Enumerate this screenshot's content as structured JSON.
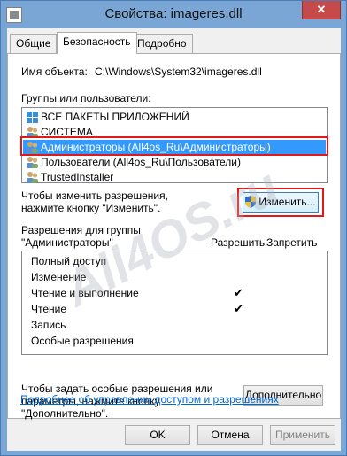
{
  "window": {
    "title": "Свойства: imageres.dll",
    "close_glyph": "✕"
  },
  "tabs": [
    {
      "label": "Общие"
    },
    {
      "label": "Безопасность"
    },
    {
      "label": "Подробно"
    }
  ],
  "security": {
    "object_label": "Имя объекта:",
    "object_value": "C:\\Windows\\System32\\imageres.dll",
    "groups_label": "Группы или пользователи:",
    "groups": [
      "ВСЕ ПАКЕТЫ ПРИЛОЖЕНИЙ",
      "СИСТЕМА",
      "Администраторы (All4os_Ru\\Администраторы)",
      "Пользователи (All4os_Ru\\Пользователи)",
      "TrustedInstaller"
    ],
    "selected_group_index": 2,
    "change_hint": "Чтобы изменить разрешения,\nнажмите кнопку \"Изменить\".",
    "change_hint_line1": "Чтобы изменить разрешения,",
    "change_hint_line2": "нажмите кнопку \"Изменить\".",
    "change_button": "Изменить...",
    "perm_label_line1": "Разрешения для группы",
    "perm_label_line2": "\"Администраторы\"",
    "allow_header": "Разрешить",
    "deny_header": "Запретить",
    "permissions": [
      {
        "name": "Полный доступ",
        "allow": false,
        "deny": false
      },
      {
        "name": "Изменение",
        "allow": false,
        "deny": false
      },
      {
        "name": "Чтение и выполнение",
        "allow": true,
        "deny": false
      },
      {
        "name": "Чтение",
        "allow": true,
        "deny": false
      },
      {
        "name": "Запись",
        "allow": false,
        "deny": false
      },
      {
        "name": "Особые разрешения",
        "allow": false,
        "deny": false
      }
    ],
    "check_glyph": "✔",
    "advanced_hint_line1": "Чтобы задать особые разрешения или",
    "advanced_hint_line2": "параметры, нажмите кнопку",
    "advanced_hint_line3": "\"Дополнительно\".",
    "advanced_button": "Дополнительно",
    "help_link": "Подробнее об управлении доступом и разрешениях"
  },
  "footer": {
    "ok": "OK",
    "cancel": "Отмена",
    "apply": "Применить"
  },
  "watermark": "All4OS.ru",
  "colors": {
    "selection": "#3399ff",
    "highlight_frame": "#e01a1a",
    "link": "#0066cc"
  }
}
